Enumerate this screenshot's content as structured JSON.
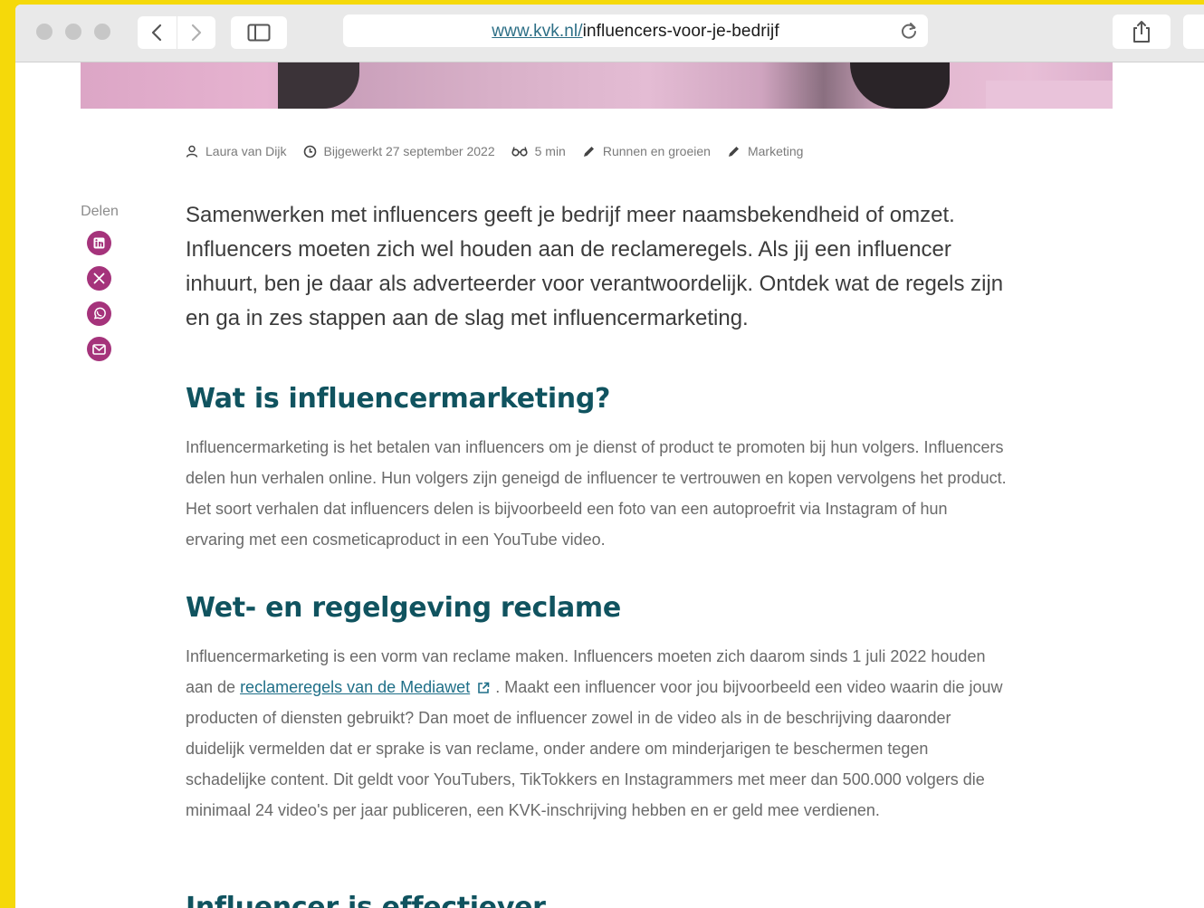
{
  "browser": {
    "url_host": "www.kvk.nl/",
    "url_path": "influencers-voor-je-bedrijf"
  },
  "meta": {
    "author": "Laura van Dijk",
    "updated": "Bijgewerkt 27 september 2022",
    "read_time": "5 min",
    "category_1": "Runnen en groeien",
    "category_2": "Marketing"
  },
  "share": {
    "label": "Delen",
    "items": [
      "linkedin-icon",
      "x-icon",
      "whatsapp-icon",
      "mail-icon"
    ]
  },
  "article": {
    "intro": "Samenwerken met influencers geeft je bedrijf meer naamsbekendheid of omzet. Influencers moeten zich wel houden aan de reclameregels. Als jij een influencer inhuurt, ben je daar als adverteerder voor verantwoordelijk. Ontdek wat de regels zijn en ga in zes stappen aan de slag met influencermarketing.",
    "h_wat": "Wat is influencermarketing?",
    "p_wat": "Influencermarketing is het betalen van influencers om je dienst of product te promoten bij hun volgers. Influencers delen hun verhalen online. Hun volgers zijn geneigd de influencer te vertrouwen en kopen vervolgens het product. Het soort verhalen dat influencers delen is bijvoorbeeld een foto van een autoproefrit via Instagram of hun ervaring met een cosmeticaproduct in een YouTube video.",
    "h_wet": "Wet- en regelgeving reclame",
    "p_wet_before": "Influencermarketing is een vorm van reclame maken. Influencers moeten zich daarom sinds 1 juli 2022 houden aan de ",
    "p_wet_link": "reclameregels van de Mediawet",
    "p_wet_after": ". Maakt een influencer voor jou bijvoorbeeld een video waarin die jouw producten of diensten gebruikt? Dan moet de influencer zowel in de video als in de beschrijving daaronder duidelijk vermelden dat er sprake is van reclame, onder andere om minderjarigen te beschermen tegen schadelijke content. Dit geldt voor YouTubers, TikTokkers en Instagrammers met meer dan 500.000 volgers die minimaal 24 video's per jaar publiceren, een KVK-inschrijving hebben en er geld mee verdienen.",
    "h_inf": "Influencer is effectiever"
  },
  "colors": {
    "heading": "#10535f",
    "share_icon_bg": "#a5337b",
    "link": "#1f6f88",
    "page_bg": "#f5d90a"
  }
}
